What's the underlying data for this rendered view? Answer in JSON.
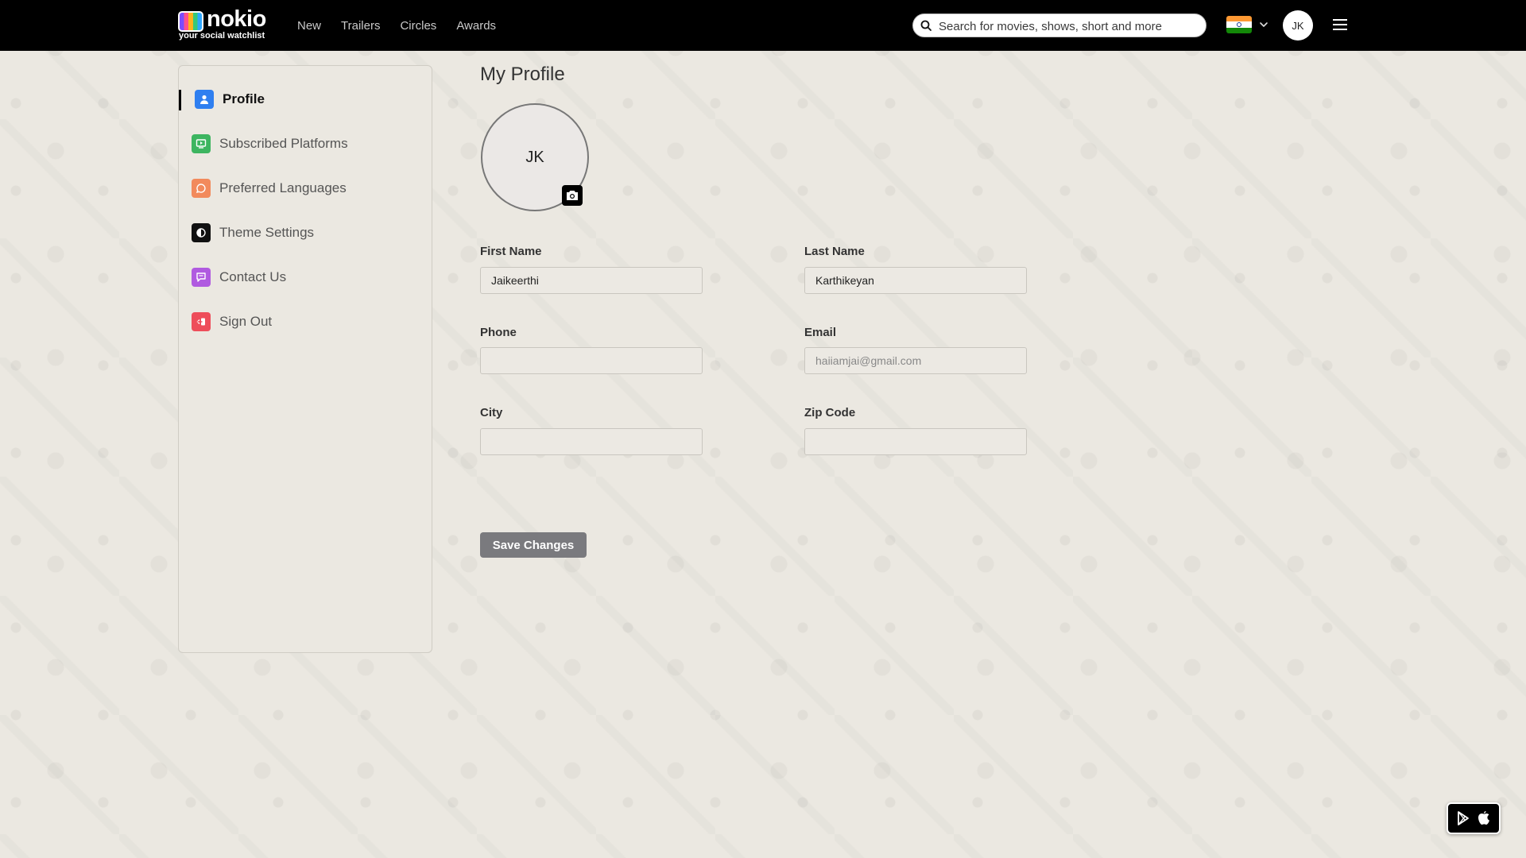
{
  "header": {
    "logo_text": "nokio",
    "logo_tagline": "your social watchlist",
    "nav": [
      "New",
      "Trailers",
      "Circles",
      "Awards"
    ],
    "search_placeholder": "Search for movies, shows, short and more",
    "user_initials": "JK"
  },
  "sidebar": {
    "items": [
      {
        "label": "Profile",
        "active": true,
        "color": "#2f7ff0",
        "icon": "person-icon"
      },
      {
        "label": "Subscribed Platforms",
        "active": false,
        "color": "#3db560",
        "icon": "play-tv-icon"
      },
      {
        "label": "Preferred Languages",
        "active": false,
        "color": "#f28a5c",
        "icon": "chat-bubble-icon"
      },
      {
        "label": "Theme Settings",
        "active": false,
        "color": "#111111",
        "icon": "contrast-icon"
      },
      {
        "label": "Contact Us",
        "active": false,
        "color": "#b05ae0",
        "icon": "message-icon"
      },
      {
        "label": "Sign Out",
        "active": false,
        "color": "#ee4d5a",
        "icon": "logout-icon"
      }
    ]
  },
  "profile": {
    "title": "My Profile",
    "avatar_initials": "JK",
    "fields": {
      "first_name": {
        "label": "First Name",
        "value": "Jaikeerthi"
      },
      "last_name": {
        "label": "Last Name",
        "value": "Karthikeyan"
      },
      "phone": {
        "label": "Phone",
        "value": ""
      },
      "email": {
        "label": "Email",
        "value": "",
        "placeholder": "haiiamjai@gmail.com"
      },
      "city": {
        "label": "City",
        "value": ""
      },
      "zip": {
        "label": "Zip Code",
        "value": ""
      }
    },
    "save_label": "Save Changes"
  },
  "colors": {
    "background": "#ebe8e1",
    "topbar": "#000000",
    "save_button": "#7a7a7e"
  }
}
